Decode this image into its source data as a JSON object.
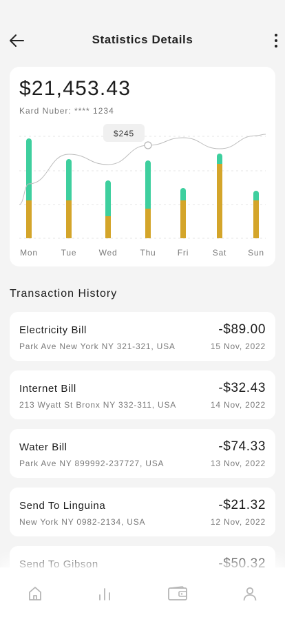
{
  "header": {
    "title": "Statistics Details",
    "back_icon": "arrow-left-icon",
    "more_icon": "more-vertical-icon"
  },
  "balance_card": {
    "balance": "$21,453.43",
    "card_number": "Kard Nuber: **** 1234"
  },
  "chart_data": {
    "type": "bar",
    "categories": [
      "Mon",
      "Tue",
      "Wed",
      "Thu",
      "Fri",
      "Sat",
      "Sun"
    ],
    "series": [
      {
        "values": [
          55,
          55,
          32,
          43,
          55,
          108,
          55
        ],
        "color": "#d4a52a"
      },
      {
        "values": [
          90,
          60,
          52,
          70,
          18,
          15,
          14
        ],
        "color": "#3ecf9e"
      }
    ],
    "trend_line": [
      0.3,
      0.73,
      0.58,
      0.86,
      0.97,
      0.81,
      1.0
    ],
    "tooltip": {
      "label": "$245",
      "category": "Thu"
    },
    "grid": true
  },
  "transactions": {
    "title": "Transaction History",
    "items": [
      {
        "name": "Electricity Bill",
        "address": "Park Ave New York NY 321-321, USA",
        "amount": "-$89.00",
        "date": "15 Nov, 2022"
      },
      {
        "name": "Internet Bill",
        "address": "213 Wyatt St Bronx NY 332-311, USA",
        "amount": "-$32.43",
        "date": "14 Nov, 2022"
      },
      {
        "name": "Water Bill",
        "address": "Park Ave NY 899992-237727, USA",
        "amount": "-$74.33",
        "date": "13 Nov, 2022"
      },
      {
        "name": "Send To Linguina",
        "address": "New York NY 0982-2134, USA",
        "amount": "-$21.32",
        "date": "12 Nov, 2022"
      },
      {
        "name": "Send To Gibson",
        "address": "",
        "amount": "-$50.32",
        "date": ""
      }
    ]
  },
  "bottom_nav": {
    "items": [
      "home-icon",
      "stats-icon",
      "wallet-icon",
      "profile-icon"
    ]
  }
}
